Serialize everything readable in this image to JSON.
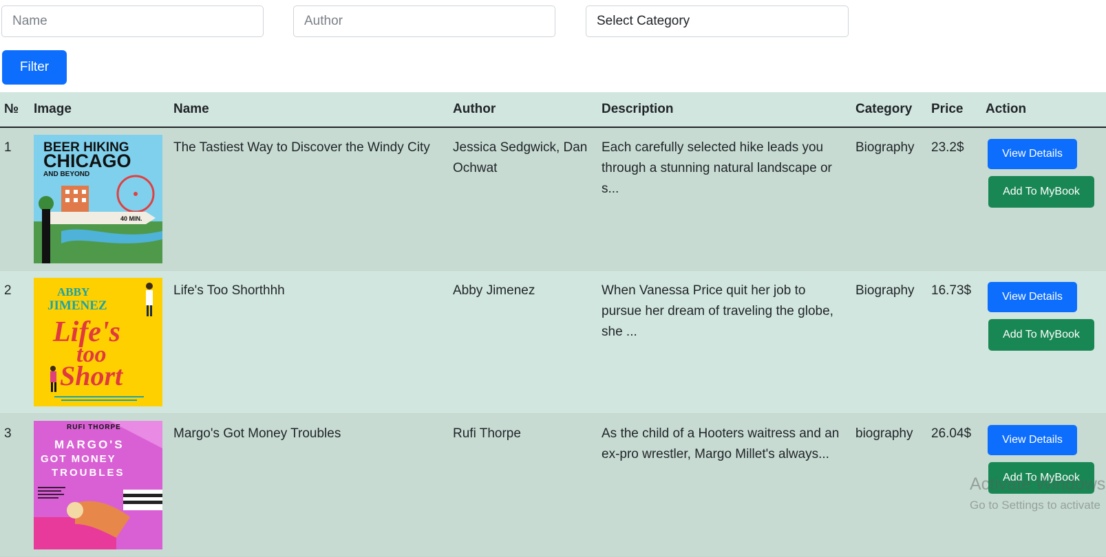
{
  "filters": {
    "name_placeholder": "Name",
    "author_placeholder": "Author",
    "category_selected": "Select Category",
    "filter_label": "Filter"
  },
  "table": {
    "headers": [
      "№",
      "Image",
      "Name",
      "Author",
      "Description",
      "Category",
      "Price",
      "Action"
    ],
    "rows": [
      {
        "no": "1",
        "cover": {
          "title_top": "BEER HIKING",
          "title_mid": "CHICAGO",
          "title_sub": "AND BEYOND",
          "sign": "40 MIN.",
          "colors": {
            "sky": "#7fd0ec",
            "grass": "#4e9a4a"
          }
        },
        "name": "The Tastiest Way to Discover the Windy City",
        "author": "Jessica Sedgwick, Dan Ochwat",
        "description": "Each carefully selected hike leads you through a stunning natural landscape or s...",
        "category": "Biography",
        "price": "23.2$",
        "view_label": "View Details",
        "add_label": "Add To MyBook"
      },
      {
        "no": "2",
        "cover": {
          "author_line1": "ABBY",
          "author_line2": "JIMENEZ",
          "t1": "Life's",
          "t2": "too",
          "t3": "Short",
          "colors": {
            "bg": "#ffd000",
            "title": "#e03a3e"
          }
        },
        "name": "Life's Too Shorthhh",
        "author": "Abby Jimenez",
        "description": "When Vanessa Price quit her job to pursue her dream of traveling the globe, she ...",
        "category": "Biography",
        "price": "16.73$",
        "view_label": "View Details",
        "add_label": "Add To MyBook"
      },
      {
        "no": "3",
        "cover": {
          "author": "RUFI THORPE",
          "t1": "MARGO'S",
          "t2": "GOT MONEY",
          "t3": "TROUBLES",
          "colors": {
            "bg": "#d960d4"
          }
        },
        "name": "Margo's Got Money Troubles",
        "author": "Rufi Thorpe",
        "description": "As the child of a Hooters waitress and an ex-pro wrestler, Margo Millet's always...",
        "category": "biography",
        "price": "26.04$",
        "view_label": "View Details",
        "add_label": "Add To MyBook"
      }
    ]
  },
  "watermark": {
    "line1": "Activate Windows",
    "line2": "Go to Settings to activate"
  }
}
